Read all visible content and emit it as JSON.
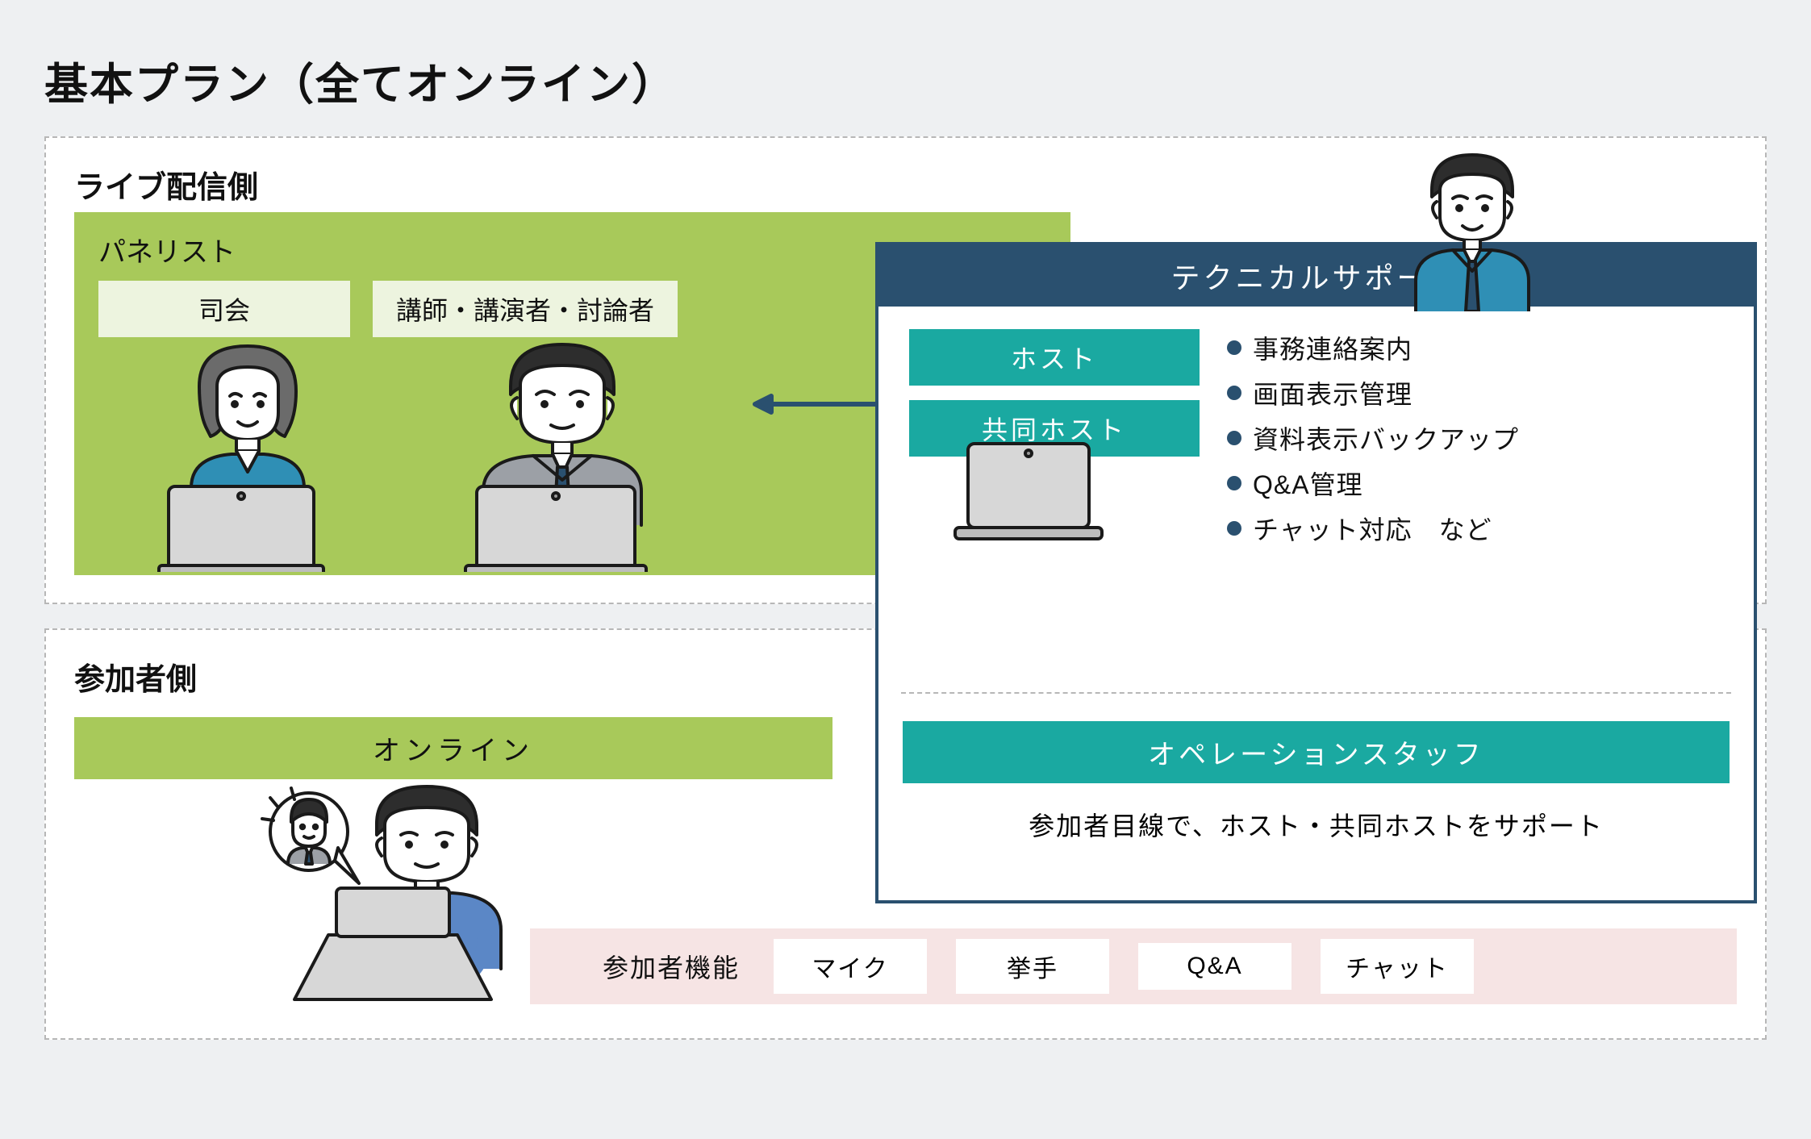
{
  "title": "基本プラン（全てオンライン）",
  "live": {
    "section_label": "ライブ配信側",
    "panelist": {
      "title": "パネリスト",
      "roles": {
        "mc": "司会",
        "speaker": "講師・講演者・討論者"
      }
    }
  },
  "tech": {
    "header": "テクニカルサポート",
    "host": "ホスト",
    "cohost": "共同ホスト",
    "bullets": [
      "事務連絡案内",
      "画面表示管理",
      "資料表示バックアップ",
      "Q&A管理",
      "チャット対応　など"
    ],
    "op_staff": "オペレーションスタッフ",
    "op_desc": "参加者目線で、ホスト・共同ホストをサポート"
  },
  "participant": {
    "section_label": "参加者側",
    "online": "オンライン",
    "features_label": "参加者機能",
    "features": [
      "マイク",
      "挙手",
      "Q&A",
      "チャット"
    ]
  },
  "colors": {
    "green": "#a8c95a",
    "teal": "#1aa9a1",
    "navy": "#2a506f",
    "pink": "#f6e4e4"
  }
}
